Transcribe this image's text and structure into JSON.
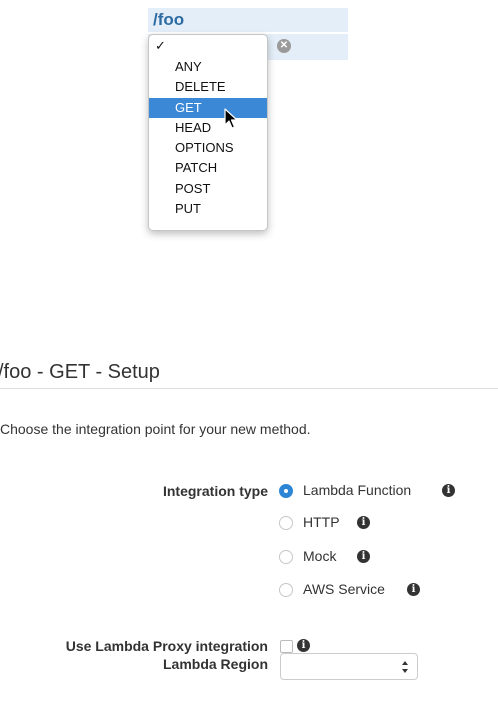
{
  "resource_tree": {
    "resource_path": "/foo",
    "method_dropdown": {
      "checkmark": "✓",
      "options": [
        "ANY",
        "DELETE",
        "GET",
        "HEAD",
        "OPTIONS",
        "PATCH",
        "POST",
        "PUT"
      ],
      "highlighted": "GET"
    }
  },
  "setup": {
    "title": "/foo - GET - Setup",
    "intro": "Choose the integration point for your new method.",
    "integration_type": {
      "label": "Integration type",
      "options": [
        "Lambda Function",
        "HTTP",
        "Mock",
        "AWS Service"
      ],
      "selected": "Lambda Function"
    },
    "proxy": {
      "label": "Use Lambda Proxy integration",
      "checked": false
    },
    "region": {
      "label": "Lambda Region",
      "value": ""
    },
    "info_glyph": "i"
  },
  "colors": {
    "accent": "#2d86d5",
    "highlight": "#3b88d6",
    "resource_bg": "#e4eef8",
    "resource_text": "#2d6ca2"
  }
}
